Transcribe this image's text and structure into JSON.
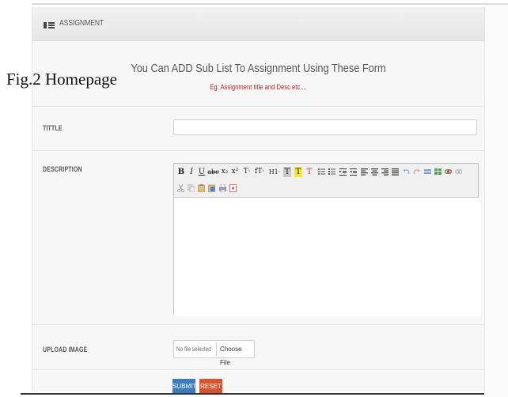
{
  "header": {
    "title": "ASSIGNMENT",
    "icon": "list-icon"
  },
  "form": {
    "title": "You Can ADD Sub List To Assignment Using These Form",
    "subtitle": "Eg: Assignment title and Desc etc....",
    "title_label": "TITTLE",
    "title_value": "",
    "description_label": "DESCRIPTION",
    "upload_label": "UPLOAD IMAGE",
    "file_status": "No file selected",
    "choose_file_label": "Choose File",
    "submit_label": "SUBMIT",
    "reset_label": "RESET"
  },
  "toolbar": {
    "row1": [
      "B",
      "I",
      "U",
      "abc",
      "x₂",
      "x²",
      "T·",
      "fT·",
      "H1·",
      "T",
      "T",
      "T",
      "list-ul",
      "list-ol",
      "indent",
      "outdent",
      "align-left",
      "align-center",
      "align-right",
      "align-justify",
      "undo",
      "redo",
      "hr",
      "table",
      "link",
      "unlink"
    ],
    "row2": [
      "cut",
      "copy",
      "paste",
      "paste-word",
      "print",
      "source"
    ]
  },
  "caption": "Fig.2 Homepage",
  "colors": {
    "submit": "#3b7bbf",
    "reset": "#d9532c",
    "subtitle": "#b52222"
  }
}
